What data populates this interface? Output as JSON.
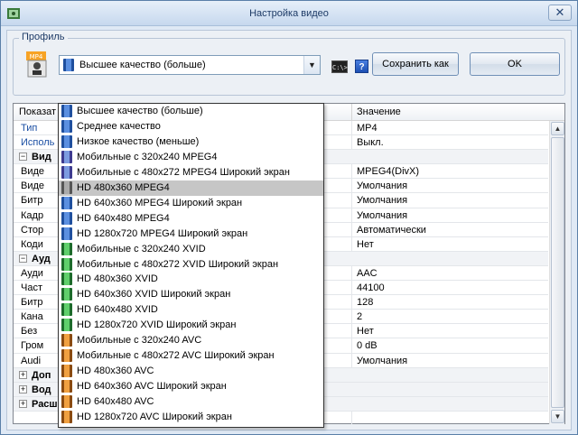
{
  "window": {
    "title": "Настройка видео",
    "close_label": "✕"
  },
  "profile": {
    "group_label": "Профиль",
    "selected_value": "Высшее качество (больше)",
    "icon_label": "MP4"
  },
  "toolbar": {
    "cmd_label": "C:\\>",
    "help_label": "?",
    "save_label": "Сохранить как",
    "ok_label": "OK"
  },
  "grid": {
    "header_name": "Показат",
    "header_value": "Значение",
    "rows": [
      {
        "name": "Тип",
        "value": "MP4"
      },
      {
        "name": "Исполь",
        "value": "Выкл."
      },
      {
        "name": "Вид",
        "value": ""
      },
      {
        "name": "Виде",
        "value": "MPEG4(DivX)"
      },
      {
        "name": "Виде",
        "value": "Умолчания"
      },
      {
        "name": "Битр",
        "value": "Умолчания"
      },
      {
        "name": "Кадр",
        "value": "Умолчания"
      },
      {
        "name": "Стор",
        "value": "Автоматически"
      },
      {
        "name": "Коди",
        "value": "Нет"
      },
      {
        "name": "Ауд",
        "value": ""
      },
      {
        "name": "Ауди",
        "value": "AAC"
      },
      {
        "name": "Част",
        "value": "44100"
      },
      {
        "name": "Битр",
        "value": "128"
      },
      {
        "name": "Кана",
        "value": "2"
      },
      {
        "name": "Без",
        "value": "Нет"
      },
      {
        "name": "Гром",
        "value": "0 dB"
      },
      {
        "name": "Audi",
        "value": "Умолчания"
      },
      {
        "name": "Доп",
        "value": ""
      },
      {
        "name": "Вод",
        "value": ""
      },
      {
        "name": "Расширенный",
        "value": ""
      }
    ]
  },
  "dropdown": {
    "options": [
      {
        "label": "Высшее качество (больше)",
        "icon": "blue"
      },
      {
        "label": "Среднее качество",
        "icon": "blue"
      },
      {
        "label": "Низкое качество (меньше)",
        "icon": "blue"
      },
      {
        "label": "Мобильные с 320x240 MPEG4",
        "icon": "purple"
      },
      {
        "label": "Мобильные с 480x272 MPEG4 Широкий экран",
        "icon": "purple"
      },
      {
        "label": "HD 480x360 MPEG4",
        "icon": "grey"
      },
      {
        "label": "HD 640x360 MPEG4 Широкий экран",
        "icon": "blue"
      },
      {
        "label": "HD 640x480 MPEG4",
        "icon": "blue"
      },
      {
        "label": "HD 1280x720 MPEG4 Широкий экран",
        "icon": "blue"
      },
      {
        "label": "Мобильные с 320x240 XVID",
        "icon": "green"
      },
      {
        "label": "Мобильные с 480x272 XVID Широкий экран",
        "icon": "green"
      },
      {
        "label": "HD 480x360 XVID",
        "icon": "green"
      },
      {
        "label": "HD 640x360 XVID Широкий экран",
        "icon": "green"
      },
      {
        "label": "HD 640x480 XVID",
        "icon": "green"
      },
      {
        "label": "HD 1280x720 XVID Широкий экран",
        "icon": "green"
      },
      {
        "label": "Мобильные с 320x240 AVC",
        "icon": "orange"
      },
      {
        "label": "Мобильные с 480x272 AVC Широкий экран",
        "icon": "orange"
      },
      {
        "label": "HD 480x360 AVC",
        "icon": "orange"
      },
      {
        "label": "HD 640x360 AVC Широкий экран",
        "icon": "orange"
      },
      {
        "label": "HD 640x480 AVC",
        "icon": "orange"
      },
      {
        "label": "HD 1280x720 AVC Широкий экран",
        "icon": "orange"
      }
    ],
    "selected_index": 5
  }
}
